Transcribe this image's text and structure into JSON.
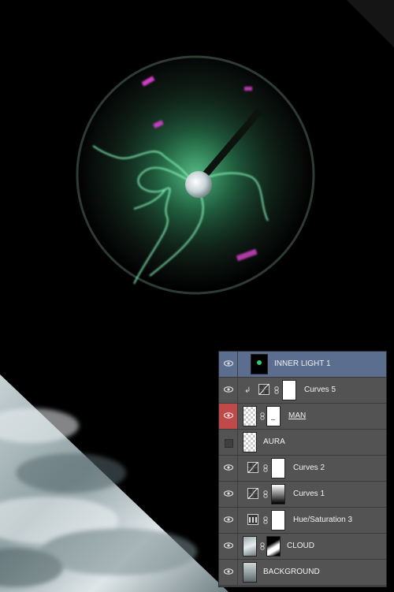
{
  "layers_panel": {
    "layers": [
      {
        "name": "INNER LIGHT 1",
        "visible": true,
        "selected": true,
        "type": "image"
      },
      {
        "name": "Curves 5",
        "visible": true,
        "selected": false,
        "type": "curves",
        "clipped": true
      },
      {
        "name": "MAN",
        "visible": true,
        "selected": false,
        "type": "masked",
        "eye_highlight": true
      },
      {
        "name": "AURA",
        "visible": false,
        "selected": false,
        "type": "transparent"
      },
      {
        "name": "Curves 2",
        "visible": true,
        "selected": false,
        "type": "curves"
      },
      {
        "name": "Curves 1",
        "visible": true,
        "selected": false,
        "type": "curves"
      },
      {
        "name": "Hue/Saturation 3",
        "visible": true,
        "selected": false,
        "type": "hue_saturation"
      },
      {
        "name": "CLOUD",
        "visible": true,
        "selected": false,
        "type": "masked_image"
      },
      {
        "name": "BACKGROUND",
        "visible": true,
        "selected": false,
        "type": "image"
      }
    ]
  },
  "colors": {
    "panel_bg": "#535353",
    "selected_row": "#5b6e8f",
    "eye_highlight": "#c04a4a",
    "plasma_glow": "#3aff8a"
  },
  "icons": [
    "eye-icon",
    "chain-link-icon",
    "clipping-arrow-icon",
    "curves-icon",
    "hue-saturation-icon"
  ]
}
